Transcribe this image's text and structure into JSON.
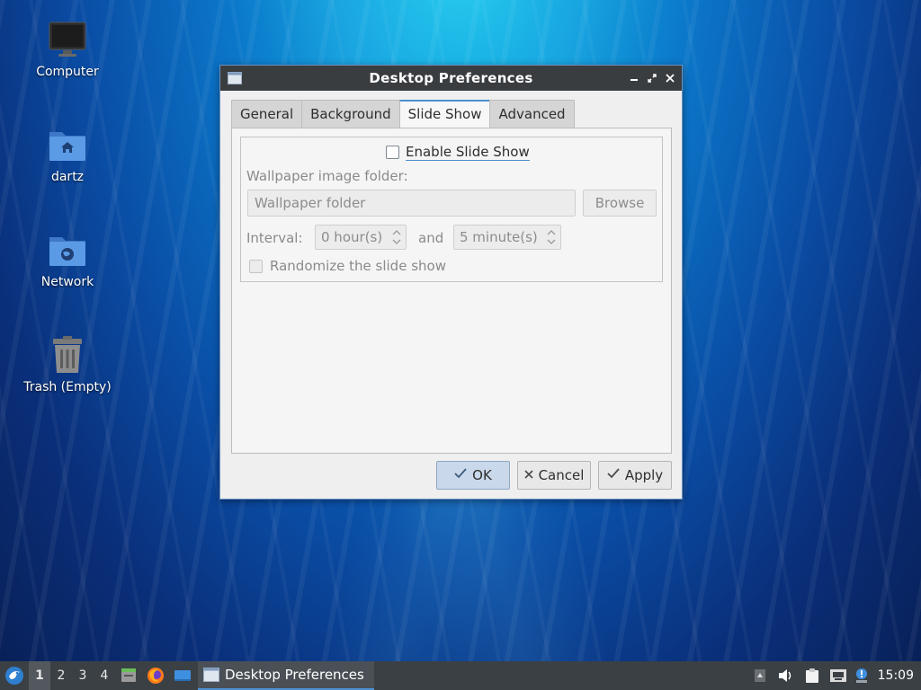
{
  "desktop": {
    "icons": [
      {
        "label": "Computer",
        "icon": "monitor-icon"
      },
      {
        "label": "dartz",
        "icon": "home-folder-icon"
      },
      {
        "label": "Network",
        "icon": "network-folder-icon"
      },
      {
        "label": "Trash (Empty)",
        "icon": "trash-icon"
      }
    ]
  },
  "window": {
    "title": "Desktop Preferences",
    "tabs": [
      {
        "label": "General"
      },
      {
        "label": "Background"
      },
      {
        "label": "Slide Show"
      },
      {
        "label": "Advanced"
      }
    ],
    "active_tab": "Slide Show",
    "slideshow": {
      "enable_label": "Enable Slide Show",
      "enable_checked": false,
      "folder_label": "Wallpaper image folder:",
      "folder_placeholder": "Wallpaper folder",
      "browse_label": "Browse",
      "interval_label": "Interval:",
      "hours_value": "0 hour(s)",
      "and_label": "and",
      "minutes_value": "5 minute(s)",
      "randomize_label": "Randomize the slide show",
      "randomize_checked": false
    },
    "buttons": {
      "ok": "OK",
      "cancel": "Cancel",
      "apply": "Apply"
    }
  },
  "taskbar": {
    "workspaces": [
      "1",
      "2",
      "3",
      "4"
    ],
    "active_workspace": "1",
    "task_title": "Desktop Preferences",
    "clock": "15:09"
  },
  "colors": {
    "accent": "#4d8fd1",
    "titlebar": "#3a3d40",
    "taskbar": "#3b4045"
  }
}
